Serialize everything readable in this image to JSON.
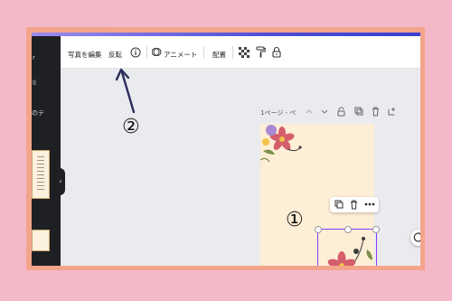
{
  "sidebar": {
    "text_top": "r",
    "text_mid": "ll",
    "text_low": "のテ"
  },
  "toolbar": {
    "edit_photo": "写真を編集",
    "flip": "反転",
    "info_icon": "info-icon",
    "animate": "アニメート",
    "position": "配置",
    "transparency_icon": "checkerboard-icon",
    "paint_icon": "paint-roller-icon",
    "lock_icon": "lock-icon"
  },
  "page_bar": {
    "label": "1ページ - ペ"
  },
  "annotations": {
    "one": "①",
    "two": "②"
  },
  "colors": {
    "pink_bg": "#f4b9c9",
    "frame": "#f3a58c",
    "canvas": "#eaebef",
    "page": "#fdeed6",
    "selection": "#8b3dff",
    "sidebar": "#1f2024"
  }
}
